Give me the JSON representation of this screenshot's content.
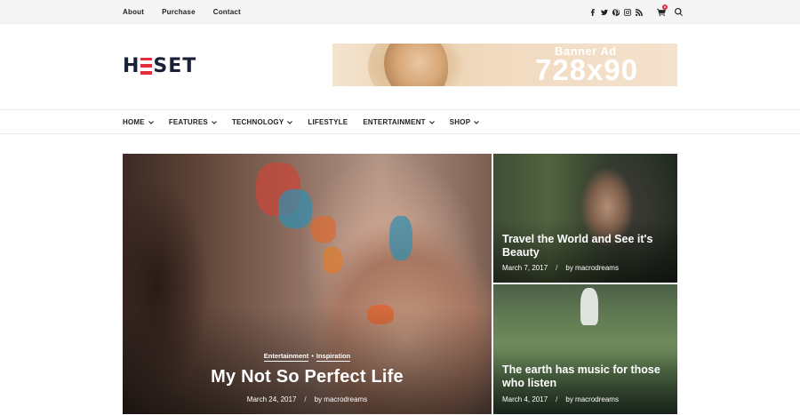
{
  "topbar": {
    "links": [
      "About",
      "Purchase",
      "Contact"
    ],
    "social_icons": [
      "facebook-icon",
      "twitter-icon",
      "pinterest-icon",
      "instagram-icon",
      "rss-icon"
    ],
    "cart_count": "0"
  },
  "logo": {
    "text_left": "H",
    "text_right": "SET"
  },
  "banner": {
    "label": "Banner Ad",
    "size": "728x90"
  },
  "nav": {
    "items": [
      {
        "label": "HOME",
        "dropdown": true
      },
      {
        "label": "FEATURES",
        "dropdown": true
      },
      {
        "label": "TECHNOLOGY",
        "dropdown": true
      },
      {
        "label": "LIFESTYLE",
        "dropdown": false
      },
      {
        "label": "ENTERTAINMENT",
        "dropdown": true
      },
      {
        "label": "SHOP",
        "dropdown": true
      }
    ]
  },
  "featured": {
    "main": {
      "categories": [
        "Entertainment",
        "Inspiration"
      ],
      "separator": "•",
      "title": "My Not So Perfect Life",
      "date": "March 24, 2017",
      "author": "by macrodreams"
    },
    "side": [
      {
        "title": "Travel the World and See it's Beauty",
        "date": "March 7, 2017",
        "author": "by macrodreams"
      },
      {
        "title": "The earth has music for those who listen",
        "date": "March 4, 2017",
        "author": "by macrodreams"
      }
    ],
    "meta_separator": "/"
  },
  "colors": {
    "accent": "#e22d3d",
    "logo": "#1a2036"
  }
}
